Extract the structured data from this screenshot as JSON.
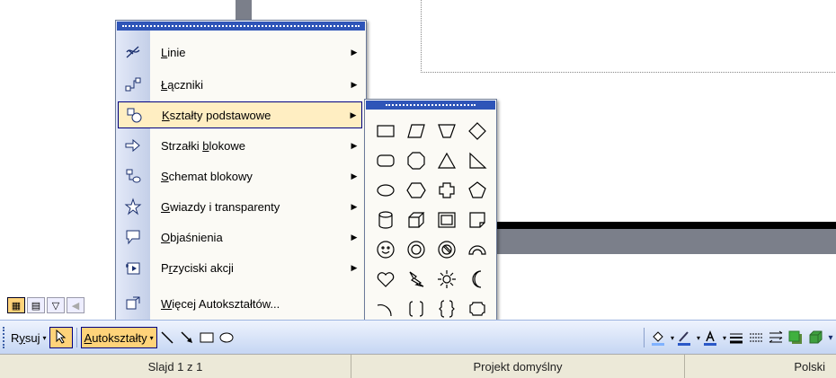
{
  "main_menu": {
    "items": [
      {
        "icon": "line-icon",
        "pre": "",
        "u": "L",
        "post": "inie",
        "arrow": "▶"
      },
      {
        "icon": "connector-icon",
        "pre": "",
        "u": "Ł",
        "post": "ączniki",
        "arrow": "▶"
      },
      {
        "icon": "basic-shapes-icon",
        "pre": "",
        "u": "K",
        "post": "ształty podstawowe",
        "arrow": "▶"
      },
      {
        "icon": "block-arrows-icon",
        "pre": "Strzałki ",
        "u": "b",
        "post": "lokowe",
        "arrow": "▶"
      },
      {
        "icon": "flowchart-icon",
        "pre": "",
        "u": "S",
        "post": "chemat blokowy",
        "arrow": "▶"
      },
      {
        "icon": "stars-banners-icon",
        "pre": "",
        "u": "G",
        "post": "wiazdy i transparenty",
        "arrow": "▶"
      },
      {
        "icon": "callouts-icon",
        "pre": "",
        "u": "O",
        "post": "bjaśnienia",
        "arrow": "▶"
      },
      {
        "icon": "action-buttons-icon",
        "pre": "P",
        "u": "r",
        "post": "zyciski akcji",
        "arrow": "▶"
      },
      {
        "icon": "more-autoshapes-icon",
        "pre": "",
        "u": "W",
        "post": "ięcej Autokształtów...",
        "arrow": ""
      }
    ]
  },
  "toolbar": {
    "draw_pre": "R",
    "draw_u": "y",
    "draw_post": "suj",
    "autoshapes_pre": "",
    "autoshapes_u": "A",
    "autoshapes_post": "utokształty",
    "dropdown": "▾"
  },
  "status": {
    "slide": "Slajd 1 z 1",
    "design": "Projekt domyślny",
    "language": "Polski"
  },
  "colors": {
    "menu_highlight": "#ffeec2",
    "grip_bar": "#2f55b8",
    "toolbar_top": "#eef3fd",
    "toolbar_bottom": "#c4d5f3"
  }
}
